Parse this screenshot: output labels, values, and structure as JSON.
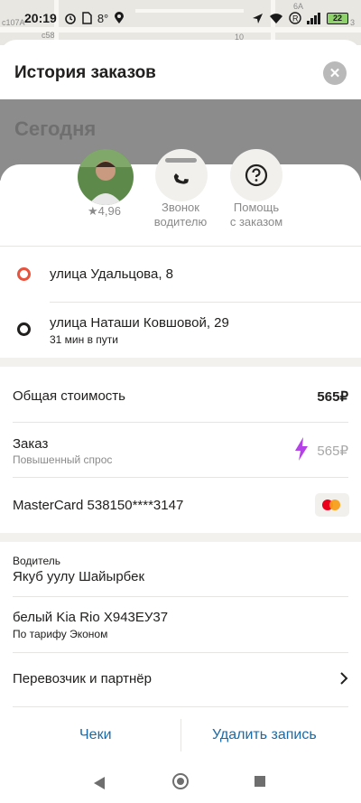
{
  "status_bar": {
    "time": "20:19",
    "temp": "8°",
    "battery": "22"
  },
  "map_labels": [
    "с107А",
    "с58",
    "10",
    "6А",
    "3"
  ],
  "header": {
    "title": "История заказов",
    "section_today": "Сегодня"
  },
  "driver": {
    "rating": "★4,96"
  },
  "actions": [
    {
      "label": "Звонок водителю",
      "icon": "phone-icon"
    },
    {
      "label": "Помощь с заказом",
      "icon": "question-icon"
    }
  ],
  "route": {
    "from": "улица Удальцова, 8",
    "to": "улица Наташи Ковшовой, 29",
    "duration": "31 мин в пути",
    "from_color": "#e8533e",
    "to_color": "#21201f"
  },
  "payment": {
    "total_label": "Общая стоимость",
    "total_value": "565₽",
    "order_label": "Заказ",
    "order_sub": "Повышенный спрос",
    "order_value": "565₽",
    "surge_icon": "lightning-icon",
    "card_label": "MasterCard 538150****3147"
  },
  "driver_info": {
    "heading": "Водитель",
    "name": "Якуб уулу Шайырбек",
    "car": "белый Kia Rio Х943ЕУ37",
    "tariff": "По тарифу Эконом",
    "partner_label": "Перевозчик и партнёр"
  },
  "footer": {
    "receipts_label": "Чеки",
    "delete_label": "Удалить запись"
  },
  "colors": {
    "accent_link": "#1a6aa8",
    "surge": "#b541e8",
    "dim": "#8c8c8c"
  }
}
